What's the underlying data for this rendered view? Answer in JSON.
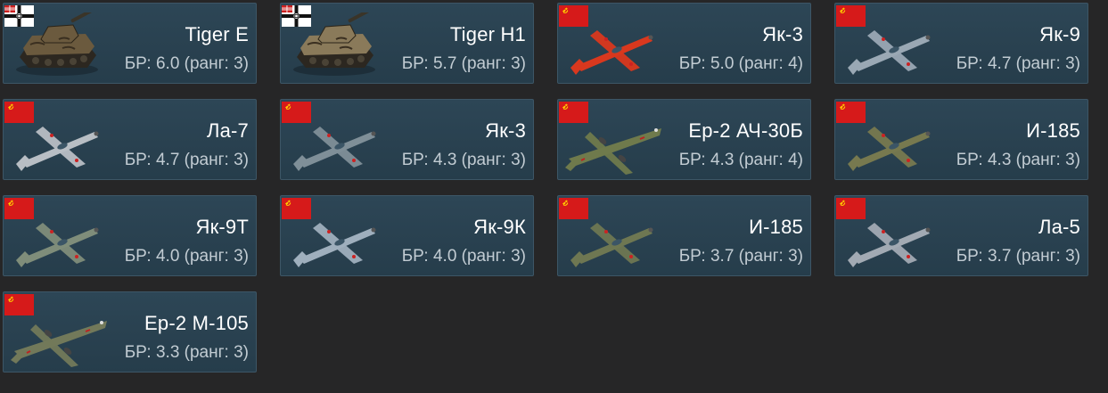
{
  "vehicles": [
    {
      "name": "Tiger E",
      "br_text": "БР: 6.0 (ранг: 3)",
      "nation": "germany",
      "kind": "tank",
      "tint": "#6b5a3e"
    },
    {
      "name": "Tiger H1",
      "br_text": "БР: 5.7 (ранг: 3)",
      "nation": "germany",
      "kind": "tank",
      "tint": "#8a7a5a"
    },
    {
      "name": "Як-3",
      "br_text": "БР: 5.0 (ранг: 4)",
      "nation": "ussr",
      "kind": "fighter",
      "tint": "#d9381e"
    },
    {
      "name": "Як-9",
      "br_text": "БР: 4.7 (ранг: 3)",
      "nation": "ussr",
      "kind": "fighter",
      "tint": "#9aa8b4"
    },
    {
      "name": "Ла-7",
      "br_text": "БР: 4.7 (ранг: 3)",
      "nation": "ussr",
      "kind": "fighter",
      "tint": "#b8bec4"
    },
    {
      "name": "Як-3",
      "br_text": "БР: 4.3 (ранг: 3)",
      "nation": "ussr",
      "kind": "fighter",
      "tint": "#7f8f98"
    },
    {
      "name": "Ер-2 АЧ-30Б",
      "br_text": "БР: 4.3 (ранг: 4)",
      "nation": "ussr",
      "kind": "bomber",
      "tint": "#6f7a4c"
    },
    {
      "name": "И-185",
      "br_text": "БР: 4.3 (ранг: 3)",
      "nation": "ussr",
      "kind": "fighter",
      "tint": "#77794f"
    },
    {
      "name": "Як-9Т",
      "br_text": "БР: 4.0 (ранг: 3)",
      "nation": "ussr",
      "kind": "fighter",
      "tint": "#7f8d7a"
    },
    {
      "name": "Як-9К",
      "br_text": "БР: 4.0 (ранг: 3)",
      "nation": "ussr",
      "kind": "fighter",
      "tint": "#9fafbd"
    },
    {
      "name": "И-185",
      "br_text": "БР: 3.7 (ранг: 3)",
      "nation": "ussr",
      "kind": "fighter",
      "tint": "#6e7752"
    },
    {
      "name": "Ла-5",
      "br_text": "БР: 3.7 (ранг: 3)",
      "nation": "ussr",
      "kind": "fighter",
      "tint": "#a2aab3"
    },
    {
      "name": "Ер-2 М-105",
      "br_text": "БР: 3.3 (ранг: 3)",
      "nation": "ussr",
      "kind": "bomber",
      "tint": "#72795a"
    }
  ],
  "flag_colors": {
    "ussr_red": "#d61a1a",
    "star_gold": "#ffcc00"
  },
  "card_bg": "#2b4454",
  "page_bg": "#262627"
}
